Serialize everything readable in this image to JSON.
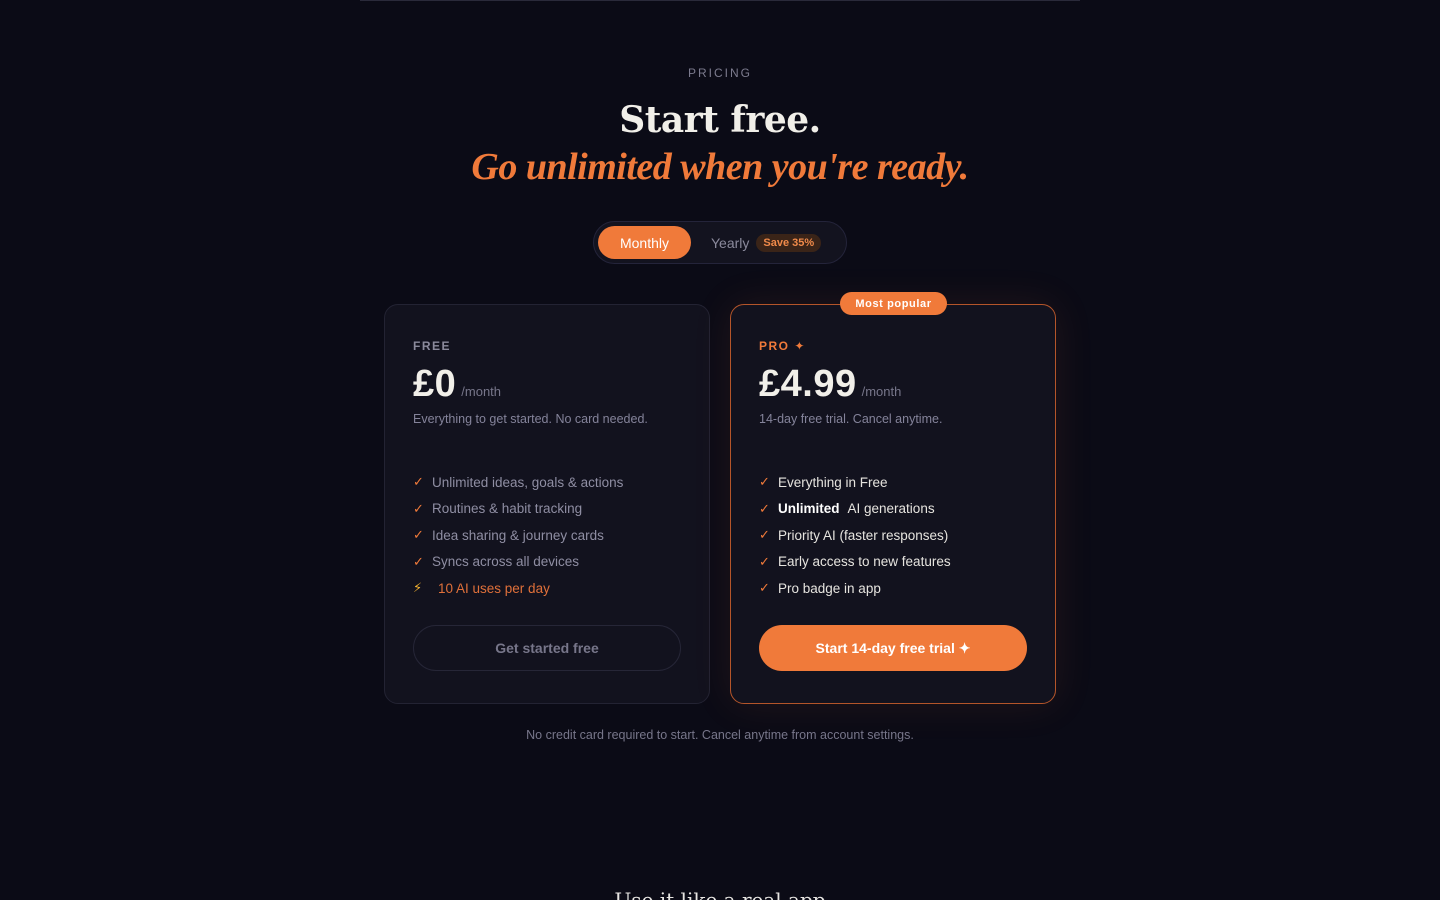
{
  "section": {
    "eyebrow": "PRICING",
    "headline": "Start free.",
    "headline_accent": "Go unlimited when you're ready."
  },
  "billing_toggle": {
    "monthly_label": "Monthly",
    "yearly_label": "Yearly",
    "save_badge": "Save 35%",
    "selected": "Monthly"
  },
  "plans": {
    "free": {
      "tier": "FREE",
      "price": "£0",
      "period": "/month",
      "subtitle": "Everything to get started. No card needed.",
      "features": [
        "Unlimited ideas, goals & actions",
        "Routines & habit tracking",
        "Idea sharing & journey cards",
        "Syncs across all devices"
      ],
      "limit": "10 AI uses per day",
      "cta": "Get started free"
    },
    "pro": {
      "badge": "Most popular",
      "tier": "PRO ✦",
      "price": "£4.99",
      "period": "/month",
      "subtitle": "14-day free trial. Cancel anytime.",
      "feature_1": "Everything in Free",
      "feature_2_strong": "Unlimited",
      "feature_2_rest": "AI generations",
      "feature_3": "Priority AI (faster responses)",
      "feature_4": "Early access to new features",
      "feature_5": "Pro badge in app",
      "cta": "Start 14-day free trial ✦"
    }
  },
  "footnote": "No credit card required to start. Cancel anytime from account settings.",
  "next_section_heading": "Use it like a real app",
  "icons": {
    "check": "✓",
    "bolt": "⚡"
  },
  "colors": {
    "background": "#0b0b16",
    "accent": "#f07a3a",
    "card": "#12121e"
  }
}
